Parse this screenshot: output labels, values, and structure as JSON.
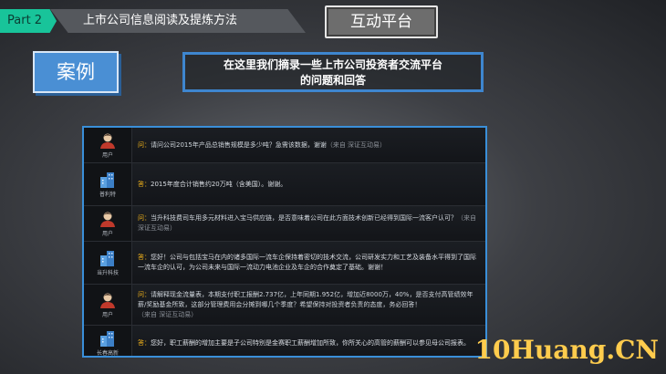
{
  "header": {
    "part_label": "Part 2",
    "section_title": "上市公司信息阅读及提炼方法",
    "platform_label": "互动平台"
  },
  "case_label": "案例",
  "caption": {
    "line1": "在这里我们摘录一些上市公司投资者交流平台",
    "line2": "的问题和回答"
  },
  "qa": [
    {
      "role_icon": "user-icon",
      "role": "用户",
      "prefix": "问：",
      "text": "请问公司2015年产品总销售规模是多少吨？急需该数据，谢谢",
      "source": "（来自 深证互动易）"
    },
    {
      "role_icon": "building-icon",
      "role": "普利特",
      "prefix": "答：",
      "text": "2015年度合计销售约20万吨（含美国）。谢谢。",
      "source": ""
    },
    {
      "role_icon": "user-icon",
      "role": "用户",
      "prefix": "问：",
      "text": "当升科技费司车用多元材料进入宝马供应链，是否意味着公司在此方面技术创新已经得到国际一流客户认可？",
      "source": "（来自 深证互动易）"
    },
    {
      "role_icon": "building-icon",
      "role": "当升科技",
      "prefix": "答：",
      "text": "您好！公司与包括宝马在内的诸多国际一流车企保持着密切的技术交流，公司研发实力和工艺及装备水平得到了国际一流车企的认可，为公司未来与国际一流动力电池企业及车企的合作奠定了基础。谢谢！",
      "source": ""
    },
    {
      "role_icon": "user-icon",
      "role": "用户",
      "prefix": "问：",
      "text": "请解释现金流量表，本期支付职工报酬2.737亿，上年同期1.952亿，增加近8000万，40%，是否支付高管绩效年薪/奖励基金所致，这部分管理费用会分摊到哪几个季度？希望保持对投资者负责的态度，务必回答！",
      "source": "（来自 深证互动易）"
    },
    {
      "role_icon": "building-icon",
      "role": "长春高新",
      "prefix": "答：",
      "text": "您好，职工薪酬的增加主要是子公司特别是金赛职工薪酬增加所致，你所关心的高管的薪酬可以参见母公司报表。",
      "source": ""
    }
  ],
  "watermark": "10Huang.CN",
  "colors": {
    "accent_green": "#18c49a",
    "accent_blue": "#3a8fd9",
    "prefix_orange": "#f1b21a",
    "watermark_gold": "#ffcc4d"
  }
}
